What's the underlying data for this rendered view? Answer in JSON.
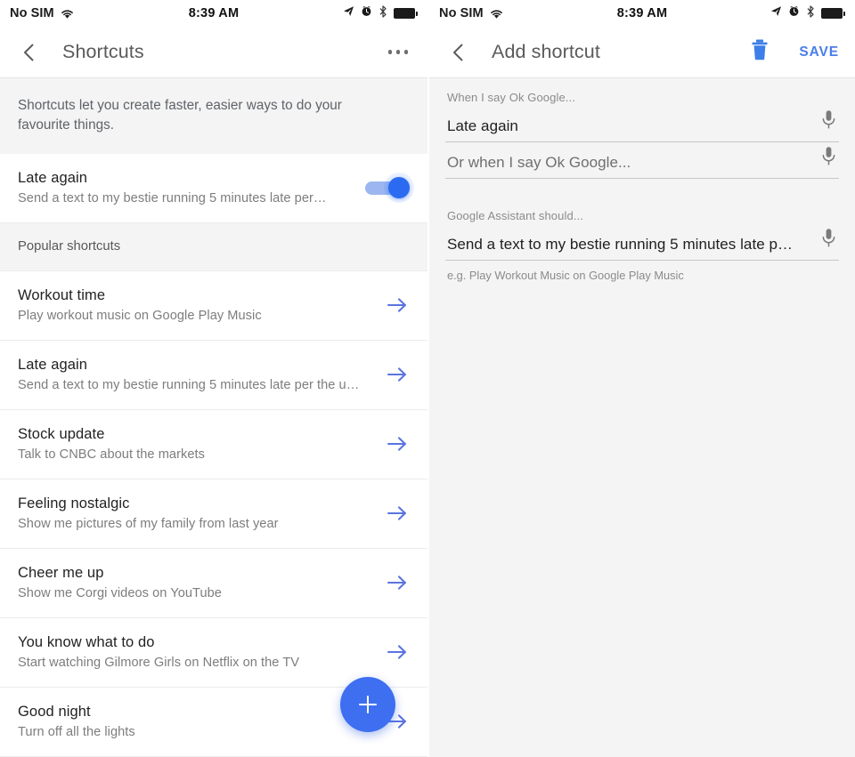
{
  "status_bar": {
    "carrier": "No SIM",
    "time": "8:39 AM",
    "icons": [
      "wifi-icon",
      "location-arrow-icon",
      "alarm-icon",
      "bluetooth-icon",
      "battery-icon"
    ]
  },
  "left_screen": {
    "appbar": {
      "back_label": "back-chevron-icon",
      "title": "Shortcuts",
      "overflow_label": "overflow-menu-icon"
    },
    "blurb": "Shortcuts let you create faster, easier ways to do your favourite things.",
    "my_shortcut": {
      "title": "Late again",
      "subtitle": "Send a text to my bestie running 5 minutes late per…",
      "toggle_on": true
    },
    "section_header": "Popular shortcuts",
    "popular": [
      {
        "title": "Workout time",
        "subtitle": "Play workout music on Google Play Music"
      },
      {
        "title": "Late again",
        "subtitle": "Send a text to my bestie running 5 minutes late per the u…"
      },
      {
        "title": "Stock update",
        "subtitle": "Talk to CNBC about the markets"
      },
      {
        "title": "Feeling nostalgic",
        "subtitle": "Show me pictures of my family from last year"
      },
      {
        "title": "Cheer me up",
        "subtitle": "Show me Corgi videos on YouTube"
      },
      {
        "title": "You know what to do",
        "subtitle": "Start watching Gilmore Girls on Netflix on the TV"
      },
      {
        "title": "Good night",
        "subtitle": "Turn off all the lights"
      }
    ],
    "fab_label": "add-shortcut-fab"
  },
  "right_screen": {
    "appbar": {
      "title": "Add shortcut",
      "delete_label": "delete-icon",
      "save_label": "SAVE"
    },
    "fields": [
      {
        "label": "When I say Ok Google...",
        "value": "Late again",
        "placeholder": "",
        "hint": ""
      },
      {
        "label": "",
        "value": "",
        "placeholder": "Or when I say Ok Google...",
        "hint": ""
      },
      {
        "label": "Google Assistant should...",
        "value": "Send a text to my bestie running 5 minutes late p…",
        "placeholder": "",
        "hint": "e.g. Play Workout Music on Google Play Music"
      }
    ]
  },
  "colors": {
    "accent_blue": "#3d6ff0",
    "arrow_blue": "#5a74e0",
    "save_blue": "#4a7ee8",
    "panel_grey": "#f4f4f4",
    "text_primary": "#222222",
    "text_secondary": "#7d7d7d"
  }
}
